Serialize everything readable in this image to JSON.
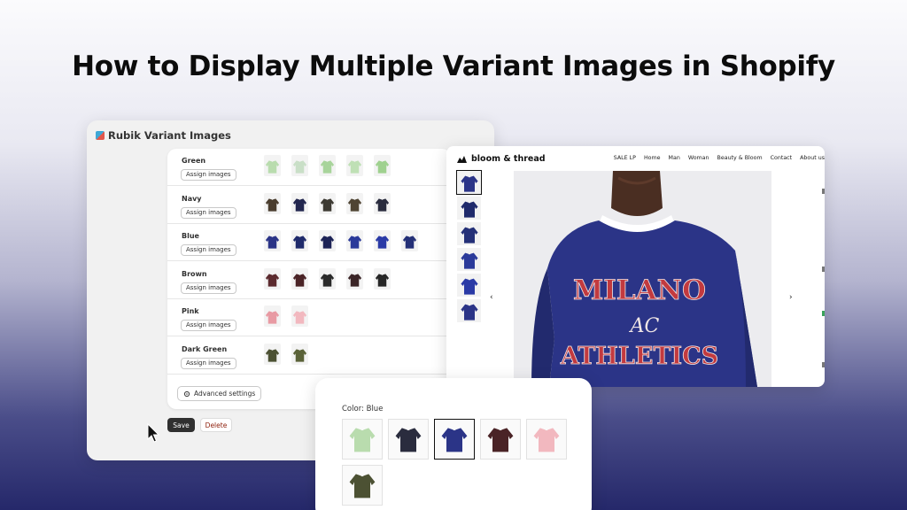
{
  "headline": "How to Display Multiple Variant Images in Shopify",
  "admin": {
    "app_title": "Rubik Variant Images",
    "assign_label": "Assign images",
    "advanced_label": "Advanced settings",
    "save_label": "Save",
    "delete_label": "Delete",
    "variants": [
      {
        "name": "Green",
        "thumb_colors": [
          "#b9dcae",
          "#c9dfc7",
          "#a8d49b",
          "#bfe0b5",
          "#9fd18f"
        ]
      },
      {
        "name": "Navy",
        "thumb_colors": [
          "#4a3d2e",
          "#22264f",
          "#3d3a33",
          "#4f4433",
          "#2a2c3e"
        ]
      },
      {
        "name": "Blue",
        "thumb_colors": [
          "#2b3487",
          "#1f2a6b",
          "#1d2356",
          "#2b3a9a",
          "#2a3aa6",
          "#243077"
        ]
      },
      {
        "name": "Brown",
        "thumb_colors": [
          "#5b2a2e",
          "#4a2326",
          "#2a2a2a",
          "#3a2426",
          "#262626"
        ]
      },
      {
        "name": "Pink",
        "thumb_colors": [
          "#e89aa3",
          "#f2b8bf"
        ]
      },
      {
        "name": "Dark Green",
        "thumb_colors": [
          "#4c5133",
          "#5a6238"
        ]
      }
    ]
  },
  "store": {
    "brand": "bloom & thread",
    "nav": [
      "SALE LP",
      "Home",
      "Man",
      "Woman",
      "Beauty & Bloom",
      "Contact",
      "About us"
    ],
    "prev_arrow": "‹",
    "next_arrow": "›",
    "side_thumb_colors": [
      "#2b3487",
      "#1f2a6b",
      "#243077",
      "#2b3a9a",
      "#2a3aa6",
      "#2b3487"
    ],
    "hero_text": {
      "line1": "MILANO",
      "monogram": "AC",
      "line2": "ATHLETICS"
    },
    "sweater_color": "#2b3487",
    "accent_color": "#c23a3f"
  },
  "selector": {
    "label": "Color: Blue",
    "swatches": [
      {
        "color": "#b9dcae",
        "selected": false
      },
      {
        "color": "#2a2c3e",
        "selected": false
      },
      {
        "color": "#2b3487",
        "selected": true
      },
      {
        "color": "#4a2326",
        "selected": false
      },
      {
        "color": "#f2b8bf",
        "selected": false
      },
      {
        "color": "#4c5133",
        "selected": false
      }
    ]
  }
}
